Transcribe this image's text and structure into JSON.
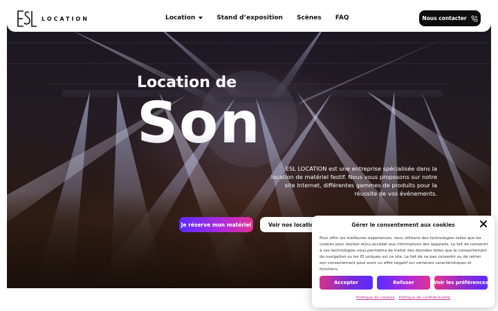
{
  "header": {
    "logo_text": "LOCATION",
    "nav": [
      {
        "label": "Location",
        "has_dropdown": true
      },
      {
        "label": "Stand d’exposition",
        "has_dropdown": false
      },
      {
        "label": "Scènes",
        "has_dropdown": false
      },
      {
        "label": "FAQ",
        "has_dropdown": false
      }
    ],
    "contact_label": "Nous contacter",
    "contact_icon": "phone-icon"
  },
  "hero": {
    "title_line1": "Location de",
    "title_line2": "Son",
    "description": "ESL LOCATION est une entreprise spécialisée dans la location de matériel festif. Nous vous proposons sur notre site Internet, différentes gammes de produits pour la réussite de vos événements.",
    "btn_reserve": "Je réserve mon matériel",
    "btn_locations": "Voir nos locations"
  },
  "cookie": {
    "title": "Gérer le consentement aux cookies",
    "text": "Pour offrir les meilleures expériences, nous utilisons des technologies telles que les cookies pour stocker et/ou accéder aux informations des appareils. Le fait de consentir à ces technologies nous permettra de traiter des données telles que le comportement de navigation ou les ID uniques sur ce site. Le fait de ne pas consentir ou de retirer son consentement peut avoir un effet négatif sur certaines caractéristiques et fonctions.",
    "accept": "Accepter",
    "refuse": "Refuser",
    "prefs": "Voir les préférences",
    "link_cookies": "Politique de cookies",
    "link_privacy": "Politique de confidentialité"
  },
  "colors": {
    "gradient_violet": "#5b2bff",
    "gradient_pink": "#e0338f",
    "link_pink": "#c2348c",
    "dark_button": "#0d0d0d"
  }
}
